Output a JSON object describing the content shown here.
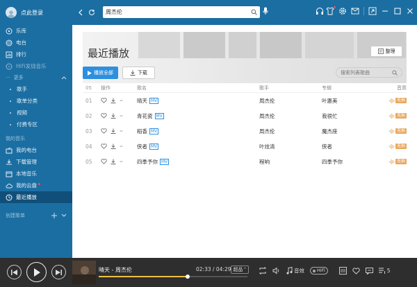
{
  "sidebar": {
    "login_text": "点此登录",
    "nav": [
      {
        "label": "乐库",
        "icon": "disc-icon"
      },
      {
        "label": "电台",
        "icon": "radio-icon"
      },
      {
        "label": "排行",
        "icon": "chart-icon"
      },
      {
        "label": "HiFi发烧音乐",
        "icon": "hifi-icon"
      }
    ],
    "more_label": "更多",
    "sub": [
      {
        "label": "歌手"
      },
      {
        "label": "歌单分类"
      },
      {
        "label": "视频"
      },
      {
        "label": "付费专区"
      }
    ],
    "my_music_label": "我的音乐",
    "mine": [
      {
        "label": "我的电台",
        "icon": "my-radio-icon"
      },
      {
        "label": "下载管理",
        "icon": "download-icon"
      },
      {
        "label": "本地音乐",
        "icon": "folder-icon"
      },
      {
        "label": "我的云盘",
        "icon": "cloud-icon"
      },
      {
        "label": "最近播放",
        "icon": "clock-icon"
      }
    ],
    "created_playlists_label": "创建歌单"
  },
  "topbar": {
    "search_value": "周杰伦"
  },
  "banner": {
    "title": "最近播放",
    "manage_label": "整理"
  },
  "toolbar": {
    "play_all": "播放全部",
    "download": "下载",
    "search_placeholder": "搜索列表歌曲"
  },
  "table": {
    "headers": {
      "op": "操作",
      "title": "歌名",
      "artist": "歌手",
      "album": "专辑",
      "quality": "音质"
    },
    "rows": [
      {
        "idx": "01",
        "title": "晴天",
        "mv": "MV",
        "artist": "周杰伦",
        "album": "叶惠美",
        "quality": "无损"
      },
      {
        "idx": "02",
        "title": "青花瓷",
        "mv": "MV",
        "artist": "周杰伦",
        "album": "我很忙",
        "quality": "无损"
      },
      {
        "idx": "03",
        "title": "稻香",
        "mv": "MV",
        "artist": "周杰伦",
        "album": "魔杰座",
        "quality": "无损"
      },
      {
        "idx": "04",
        "title": "侠者",
        "mv": "MV",
        "artist": "叶炫清",
        "album": "侠者",
        "quality": "无损"
      },
      {
        "idx": "05",
        "title": "四季予你",
        "mv": "MV",
        "artist": "程响",
        "album": "四季予你",
        "quality": "无损"
      }
    ],
    "header_idx": "05"
  },
  "player": {
    "now_playing": "晴天 - 周杰伦",
    "time": "02:33 / 04:29",
    "quality": "超品",
    "progress": 0.6,
    "sound_label": "音效",
    "hifi_label": "HiFi",
    "playlist_count": "5"
  },
  "colors": {
    "sidebar_bg": "#1b6ea2",
    "accent": "#2d8fde",
    "player_bg": "#2e2e2e",
    "quality_badge": "#e8a860"
  }
}
